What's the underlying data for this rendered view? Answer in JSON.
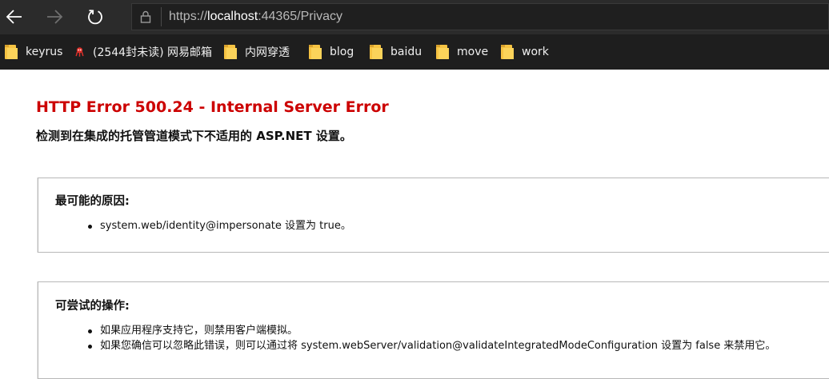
{
  "browser": {
    "url_prefix": "https://",
    "url_host": "localhost",
    "url_suffix": ":44365/Privacy",
    "bookmarks": [
      {
        "label": "keyrus",
        "icon": "folder-icon"
      },
      {
        "label": "(2544封未读) 网易邮箱",
        "icon": "mail-icon"
      },
      {
        "label": "内网穿透",
        "icon": "folder-icon"
      },
      {
        "label": "blog",
        "icon": "folder-icon"
      },
      {
        "label": "baidu",
        "icon": "folder-icon"
      },
      {
        "label": "move",
        "icon": "folder-icon"
      },
      {
        "label": "work",
        "icon": "folder-icon"
      }
    ]
  },
  "error": {
    "title": "HTTP Error 500.24 - Internal Server Error",
    "subtitle": "检测到在集成的托管管道模式下不适用的 ASP.NET 设置。"
  },
  "causes": {
    "heading": "最可能的原因:",
    "items": [
      "system.web/identity@impersonate 设置为 true。"
    ]
  },
  "actions": {
    "heading": "可尝试的操作:",
    "items": [
      "如果应用程序支持它，则禁用客户端模拟。",
      "如果您确信可以忽略此错误，则可以通过将 system.webServer/validation@validateIntegratedModeConfiguration 设置为 false 来禁用它。"
    ]
  },
  "colors": {
    "error_title": "#cc0000",
    "chrome_bg": "#2b2b2b",
    "bookmarks_bg": "#1e1e1e",
    "folder": "#f6c342"
  }
}
